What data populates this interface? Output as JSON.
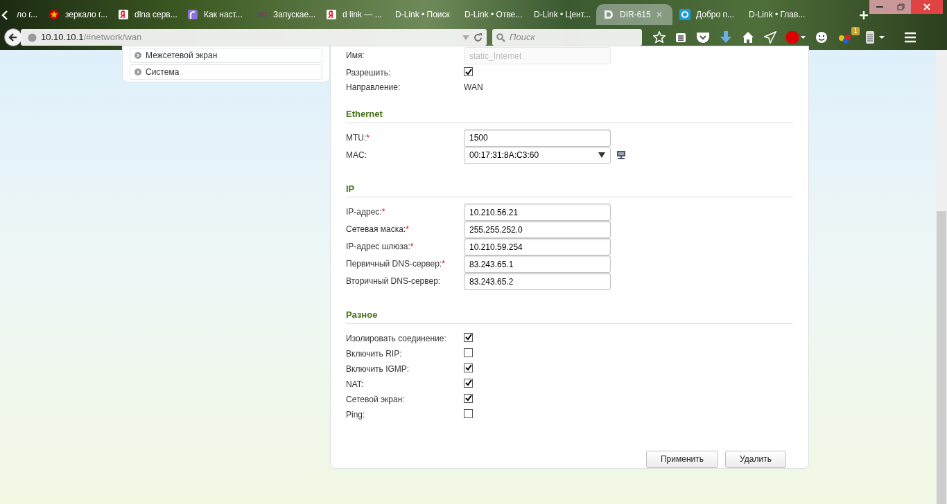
{
  "tabs": [
    {
      "title": "ло г...",
      "kind": "plain",
      "selected": false
    },
    {
      "title": "зеркало г...",
      "kind": "star",
      "selected": false
    },
    {
      "title": "dlna серв...",
      "kind": "letter",
      "selected": false
    },
    {
      "title": "Как наст...",
      "kind": "curve",
      "selected": false
    },
    {
      "title": "Запускае...",
      "kind": "device",
      "selected": false
    },
    {
      "title": "d link — ...",
      "kind": "letter",
      "selected": false
    },
    {
      "title": "D-Link • Поиск",
      "kind": "plain",
      "selected": false
    },
    {
      "title": "D-Link • Отве...",
      "kind": "plain",
      "selected": false
    },
    {
      "title": "D-Link • Цент...",
      "kind": "plain",
      "selected": false
    },
    {
      "title": "DIR-615",
      "kind": "logo",
      "selected": true
    },
    {
      "title": "Добро п...",
      "kind": "mail",
      "selected": false
    },
    {
      "title": "D-Link • Глав...",
      "kind": "plain",
      "selected": false
    }
  ],
  "address": {
    "host": "10.10.10.1",
    "path": "/#network/wan"
  },
  "search": {
    "placeholder": "Поиск"
  },
  "addon_badge": "1",
  "sidebar": {
    "items": [
      {
        "label": "Межсетевой экран"
      },
      {
        "label": "Система"
      }
    ]
  },
  "form": {
    "top_rows": [
      {
        "kind": "input",
        "label": "Имя:",
        "value": "static_Internet",
        "disabled": true
      },
      {
        "kind": "checkbox",
        "label": "Разрешить:",
        "checked": true
      },
      {
        "kind": "text",
        "label": "Направление:",
        "value": "WAN"
      }
    ],
    "sections": [
      {
        "title": "Ethernet",
        "rows": [
          {
            "kind": "input",
            "label": "MTU:",
            "mark": "*",
            "value": "1500",
            "disabled": false
          },
          {
            "kind": "select",
            "label": "MAC:",
            "value": "00:17:31:8A:C3:60"
          }
        ]
      },
      {
        "title": "IP",
        "rows": [
          {
            "kind": "input",
            "label": "IP-адрес:",
            "mark": "*",
            "value": "10.210.56.21",
            "disabled": false
          },
          {
            "kind": "input",
            "label": "Сетевая маска:",
            "mark": "*",
            "value": "255.255.252.0",
            "disabled": false
          },
          {
            "kind": "input",
            "label": "IP-адрес шлюза:",
            "mark": "*",
            "value": "10.210.59.254",
            "disabled": false
          },
          {
            "kind": "input",
            "label": "Первичный DNS-сервер:",
            "mark": "*",
            "value": "83.243.65.1",
            "disabled": false
          },
          {
            "kind": "input",
            "label": "Вторичный DNS-сервер:",
            "value": "83.243.65.2",
            "disabled": false
          }
        ]
      },
      {
        "title": "Разное",
        "rows": [
          {
            "kind": "checkbox",
            "label": "Изолировать соединение:",
            "checked": true
          },
          {
            "kind": "checkbox",
            "label": "Включить RIP:",
            "checked": false
          },
          {
            "kind": "checkbox",
            "label": "Включить IGMP:",
            "checked": true
          },
          {
            "kind": "checkbox",
            "label": "NAT:",
            "checked": true
          },
          {
            "kind": "checkbox",
            "label": "Сетевой экран:",
            "checked": true
          },
          {
            "kind": "checkbox",
            "label": "Ping:",
            "checked": false
          }
        ]
      }
    ]
  },
  "buttons": [
    "Применить",
    "Удалить"
  ]
}
